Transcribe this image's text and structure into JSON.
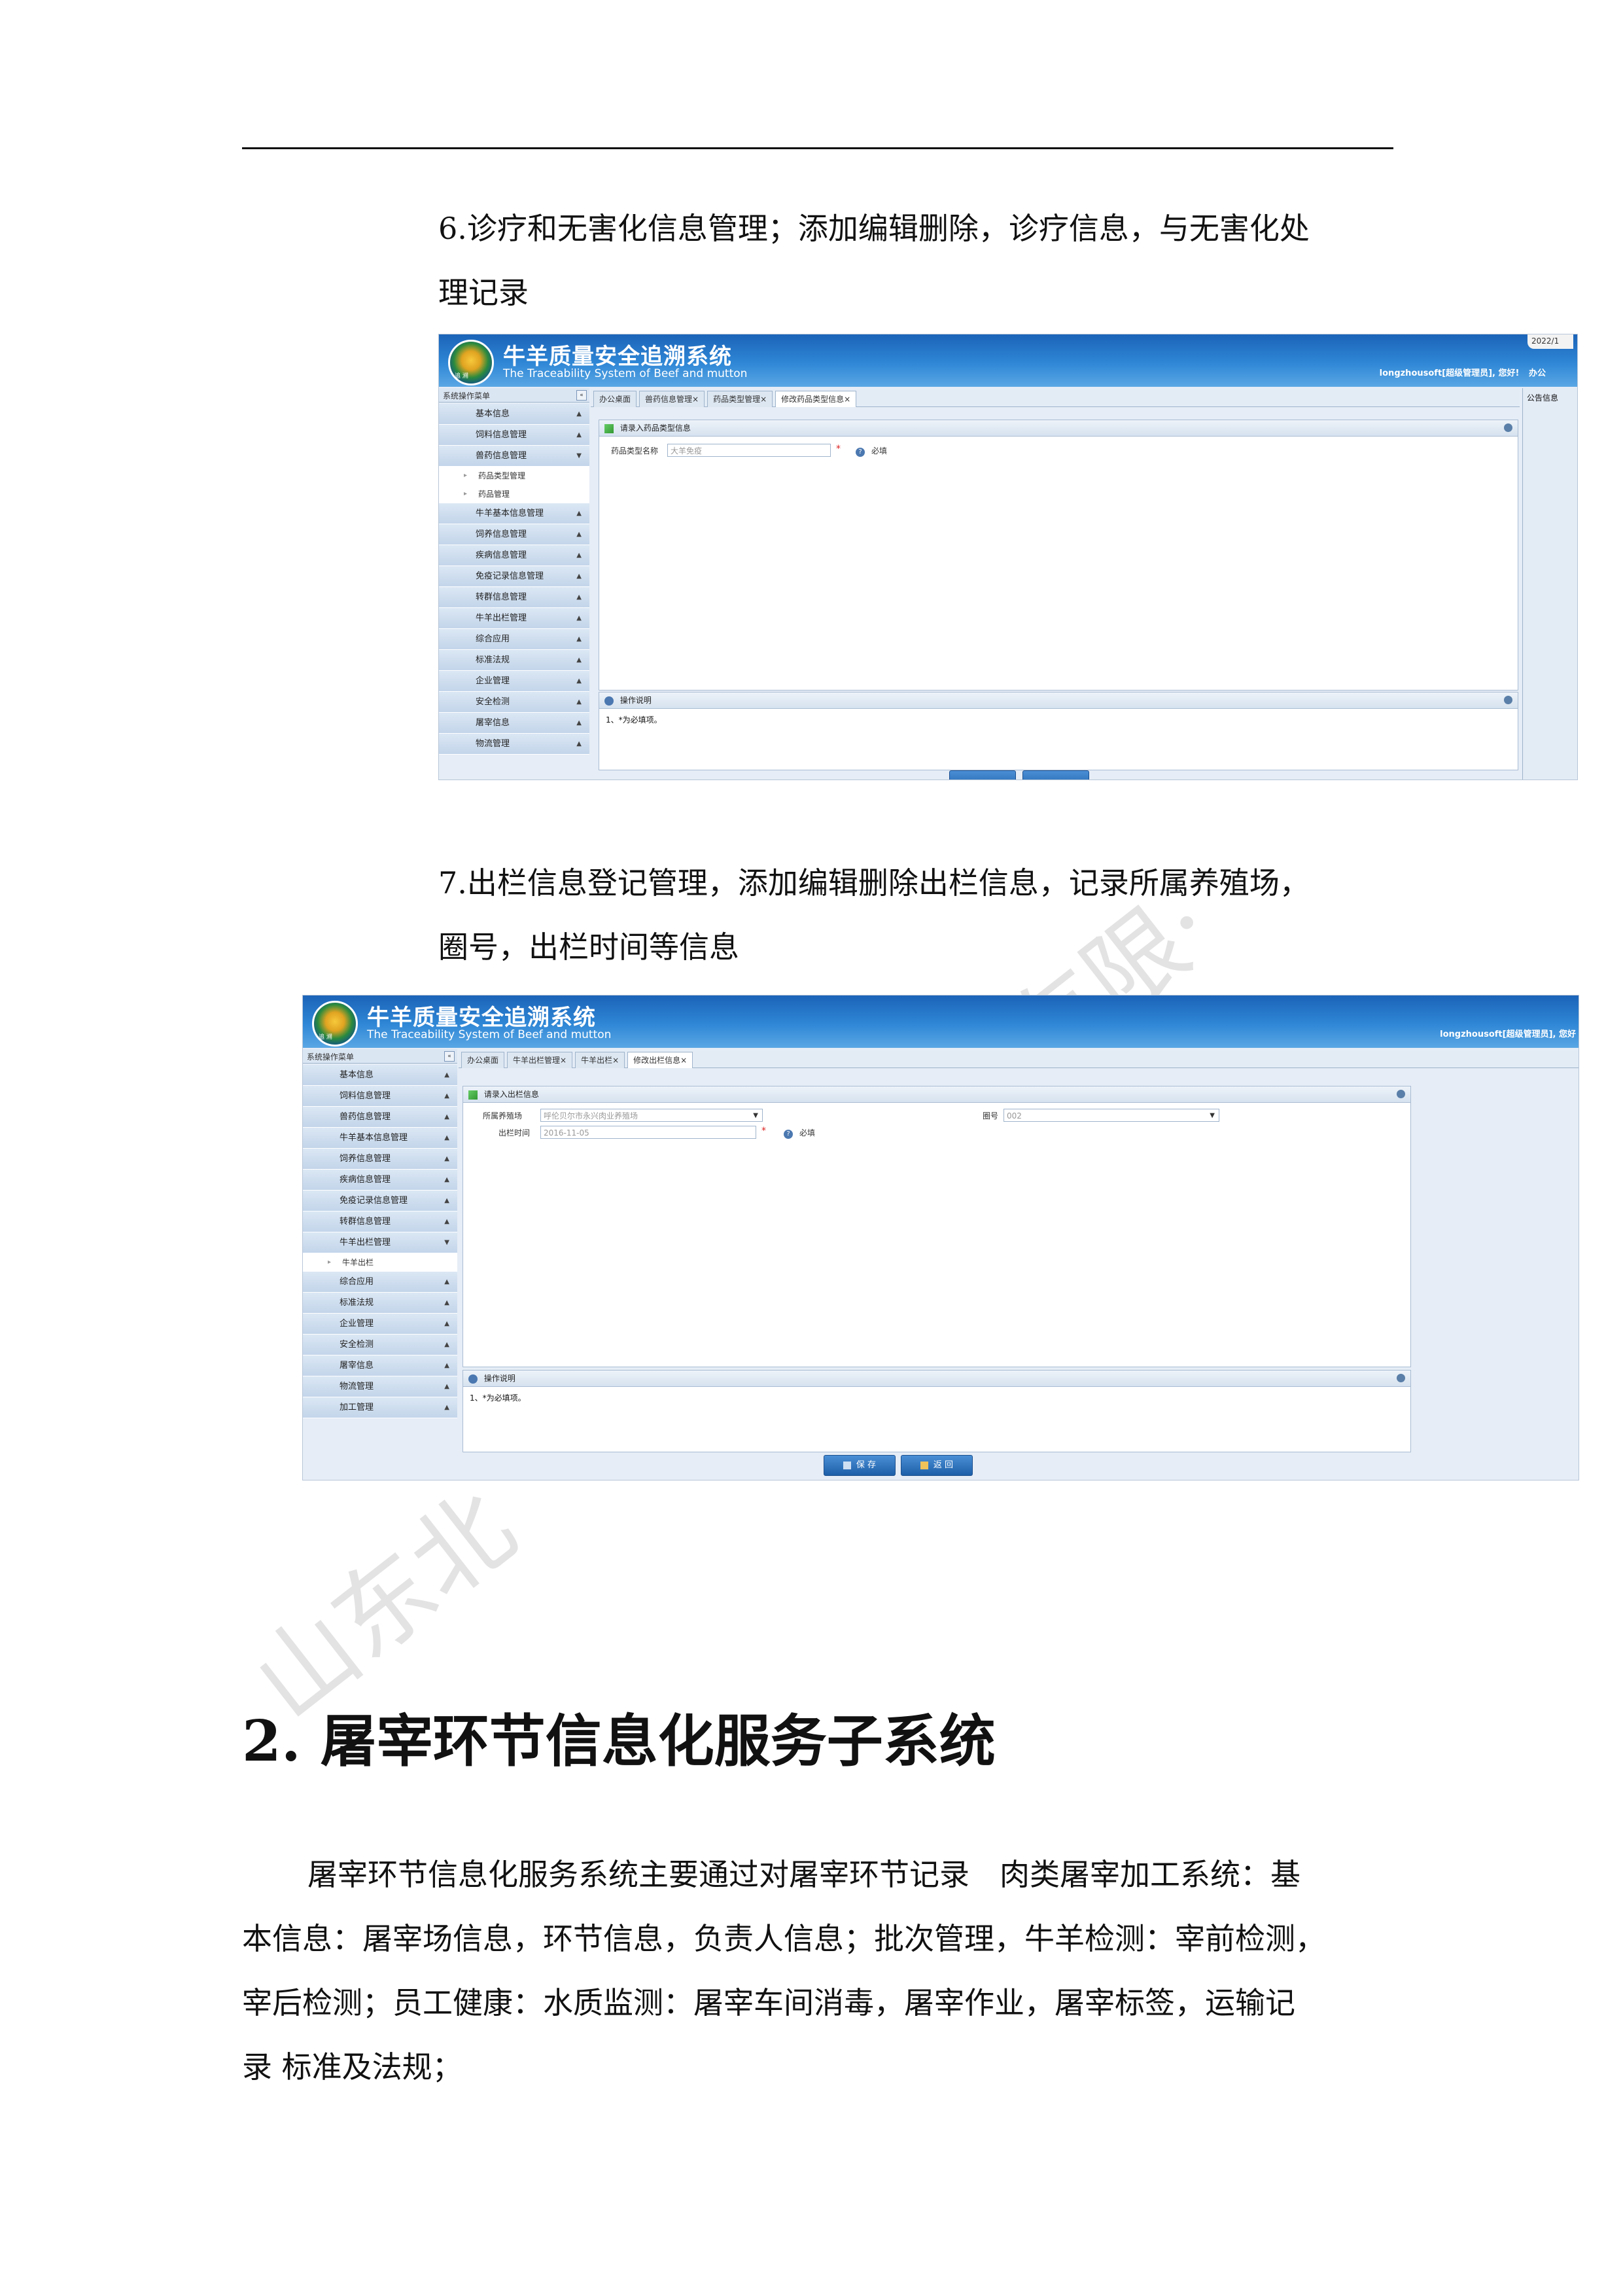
{
  "doc": {
    "item6_line1": "6.诊疗和无害化信息管理；添加编辑删除，诊疗信息，与无害化处",
    "item6_line2": "理记录",
    "item7_line1": "7.出栏信息登记管理，添加编辑删除出栏信息，记录所属养殖场，",
    "item7_line2": "圈号，出栏时间等信息",
    "section_heading": "2. 屠宰环节信息化服务子系统",
    "para_line1": "屠宰环节信息化服务系统主要通过对屠宰环节记录　肉类屠宰加工系统：基",
    "para_line2": "本信息：屠宰场信息，环节信息，负责人信息；批次管理，牛羊检测：宰前检测，",
    "para_line3": "宰后检测；员工健康：水质监测：屠宰车间消毒，屠宰作业，屠宰标签，运输记",
    "para_line4": "录  标准及法规；",
    "watermark_a": "山东北",
    "watermark_b": "份有限·"
  },
  "app": {
    "title": "牛羊质量安全追溯系统",
    "subtitle": "The Traceability System of Beef and mutton",
    "logo_text": "追 溯",
    "user1": "longzhousoft[超级管理员], 您好!",
    "user1_office": "办公",
    "user2": "longzhousoft[超级管理员], 您好",
    "date": "2022/1",
    "menu_header": "系统操作菜单",
    "collapse_glyph": "«",
    "notice": "公告信息"
  },
  "shot1": {
    "tabs": [
      "办公桌面",
      "兽药信息管理×",
      "药品类型管理×",
      "修改药品类型信息×"
    ],
    "menu": [
      {
        "label": "基本信息",
        "sub": false
      },
      {
        "label": "饲料信息管理",
        "sub": false
      },
      {
        "label": "兽药信息管理",
        "sub": false,
        "open": true
      },
      {
        "label": "药品类型管理",
        "sub": true
      },
      {
        "label": "药品管理",
        "sub": true
      },
      {
        "label": "牛羊基本信息管理",
        "sub": false
      },
      {
        "label": "饲养信息管理",
        "sub": false
      },
      {
        "label": "疾病信息管理",
        "sub": false
      },
      {
        "label": "免疫记录信息管理",
        "sub": false
      },
      {
        "label": "转群信息管理",
        "sub": false
      },
      {
        "label": "牛羊出栏管理",
        "sub": false
      },
      {
        "label": "综合应用",
        "sub": false
      },
      {
        "label": "标准法规",
        "sub": false
      },
      {
        "label": "企业管理",
        "sub": false
      },
      {
        "label": "安全检测",
        "sub": false
      },
      {
        "label": "屠宰信息",
        "sub": false
      },
      {
        "label": "物流管理",
        "sub": false
      }
    ],
    "form_title": "请录入药品类型信息",
    "field_label": "药品类型名称",
    "field_value": "大羊免疫",
    "required_mark": "*",
    "required_text": "必填",
    "notes_title": "操作说明",
    "notes_text": "1、*为必填项。"
  },
  "shot2": {
    "tabs": [
      "办公桌面",
      "牛羊出栏管理×",
      "牛羊出栏×",
      "修改出栏信息×"
    ],
    "menu": [
      {
        "label": "基本信息",
        "sub": false
      },
      {
        "label": "饲料信息管理",
        "sub": false
      },
      {
        "label": "兽药信息管理",
        "sub": false
      },
      {
        "label": "牛羊基本信息管理",
        "sub": false
      },
      {
        "label": "饲养信息管理",
        "sub": false
      },
      {
        "label": "疾病信息管理",
        "sub": false
      },
      {
        "label": "免疫记录信息管理",
        "sub": false
      },
      {
        "label": "转群信息管理",
        "sub": false
      },
      {
        "label": "牛羊出栏管理",
        "sub": false,
        "open": true
      },
      {
        "label": "牛羊出栏",
        "sub": true
      },
      {
        "label": "综合应用",
        "sub": false
      },
      {
        "label": "标准法规",
        "sub": false
      },
      {
        "label": "企业管理",
        "sub": false
      },
      {
        "label": "安全检测",
        "sub": false
      },
      {
        "label": "屠宰信息",
        "sub": false
      },
      {
        "label": "物流管理",
        "sub": false
      },
      {
        "label": "加工管理",
        "sub": false
      }
    ],
    "form_title": "请录入出栏信息",
    "farm_label": "所属养殖场",
    "farm_value": "呼伦贝尔市永兴肉业养殖场",
    "pen_label": "圈号",
    "pen_value": "002",
    "time_label": "出栏时间",
    "time_value": "2016-11-05",
    "required_mark": "*",
    "required_text": "必填",
    "notes_title": "操作说明",
    "notes_text": "1、*为必填项。",
    "save_label": "保 存",
    "back_label": "返 回"
  },
  "colors": {
    "banner": "#1b63b8",
    "button": "#1d5fa8",
    "required": "#d22222"
  }
}
